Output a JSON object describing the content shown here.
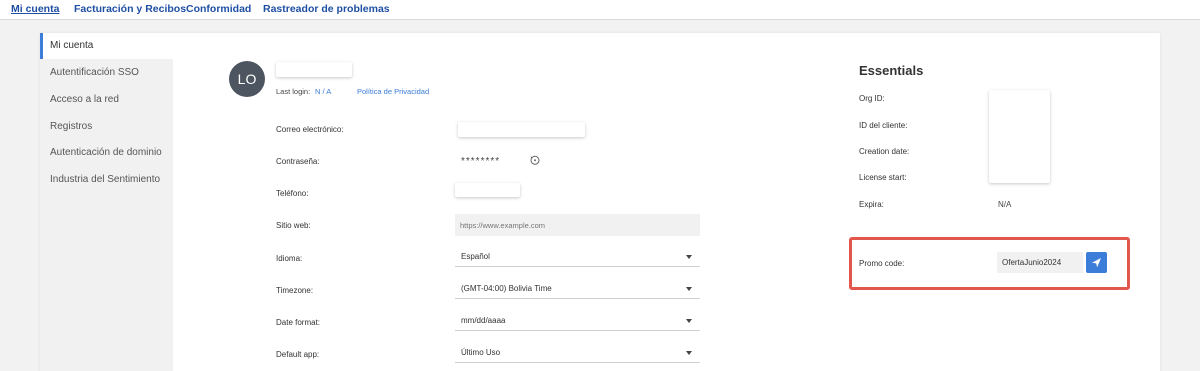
{
  "topnav": {
    "items": [
      "Mi cuenta",
      "Facturación y Recibos",
      "Conformidad",
      "Rastreador de problemas"
    ]
  },
  "sidebar": {
    "items": [
      "Mi cuenta",
      "Autentificación SSO",
      "Acceso a la red",
      "Registros",
      "Autenticación de dominio",
      "Industria del Sentimiento"
    ]
  },
  "profile": {
    "initials": "LO",
    "last_login_label": "Last login:",
    "last_login_value": "N / A",
    "privacy_link": "Política de Privacidad"
  },
  "form": {
    "email_label": "Correo electrónico:",
    "password_label": "Contraseña:",
    "password_mask": "********",
    "phone_label": "Teléfono:",
    "website_label": "Sitio web:",
    "website_placeholder": "https://www.example.com",
    "language_label": "Idioma:",
    "language_value": "Español",
    "timezone_label": "Timezone:",
    "timezone_value": "(GMT-04:00) Bolivia Time",
    "date_format_label": "Date format:",
    "date_format_value": "mm/dd/aaaa",
    "default_app_label": "Default app:",
    "default_app_value": "Último Uso"
  },
  "essentials": {
    "title": "Essentials",
    "org_id_label": "Org ID:",
    "client_id_label": "ID del cliente:",
    "creation_date_label": "Creation date:",
    "license_start_label": "License start:",
    "expires_label": "Expira:",
    "expires_value": "N/A"
  },
  "promo": {
    "label": "Promo code:",
    "value": "OfertaJunio2024",
    "submit_icon": "send-icon"
  },
  "colors": {
    "accent": "#3b7dd8",
    "nav_text": "#1f4fa3",
    "highlight_frame": "#e2574c",
    "avatar_bg": "#4d5561"
  }
}
